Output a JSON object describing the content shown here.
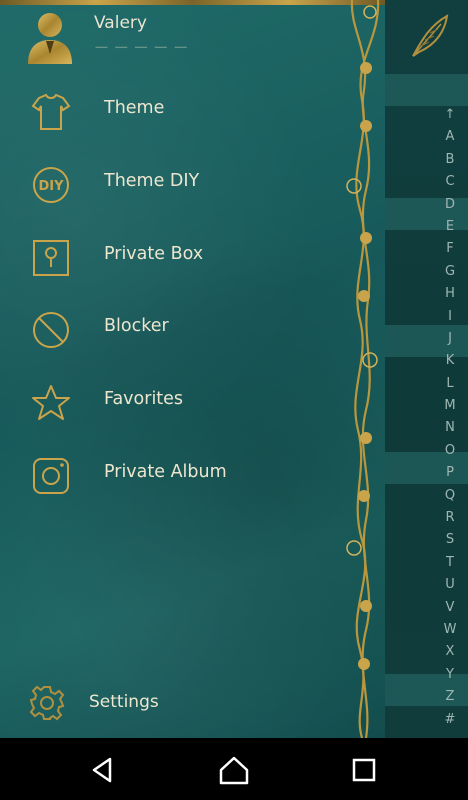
{
  "profile": {
    "name": "Valery",
    "subtitle": "ー ー ー ー ー"
  },
  "menu": [
    {
      "label": "Theme",
      "icon": "t-shirt-icon"
    },
    {
      "label": "Theme DIY",
      "icon": "diy-icon"
    },
    {
      "label": "Private Box",
      "icon": "lock-box-icon"
    },
    {
      "label": "Blocker",
      "icon": "block-icon"
    },
    {
      "label": "Favorites",
      "icon": "star-icon"
    },
    {
      "label": "Private Album",
      "icon": "camera-icon"
    }
  ],
  "settings": {
    "label": "Settings",
    "icon": "gear-icon"
  },
  "index_letters": [
    "↑",
    "A",
    "B",
    "C",
    "D",
    "E",
    "F",
    "G",
    "H",
    "I",
    "J",
    "K",
    "L",
    "M",
    "N",
    "O",
    "P",
    "Q",
    "R",
    "S",
    "T",
    "U",
    "V",
    "W",
    "X",
    "Y",
    "Z",
    "#"
  ],
  "colors": {
    "gold": "#c9a44a",
    "drawer_bg": "#1b6462",
    "index_bg": "#0f3a3a",
    "text": "#ece6cf"
  },
  "nav": {
    "back": "back-icon",
    "home": "home-icon",
    "recents": "recents-icon"
  }
}
